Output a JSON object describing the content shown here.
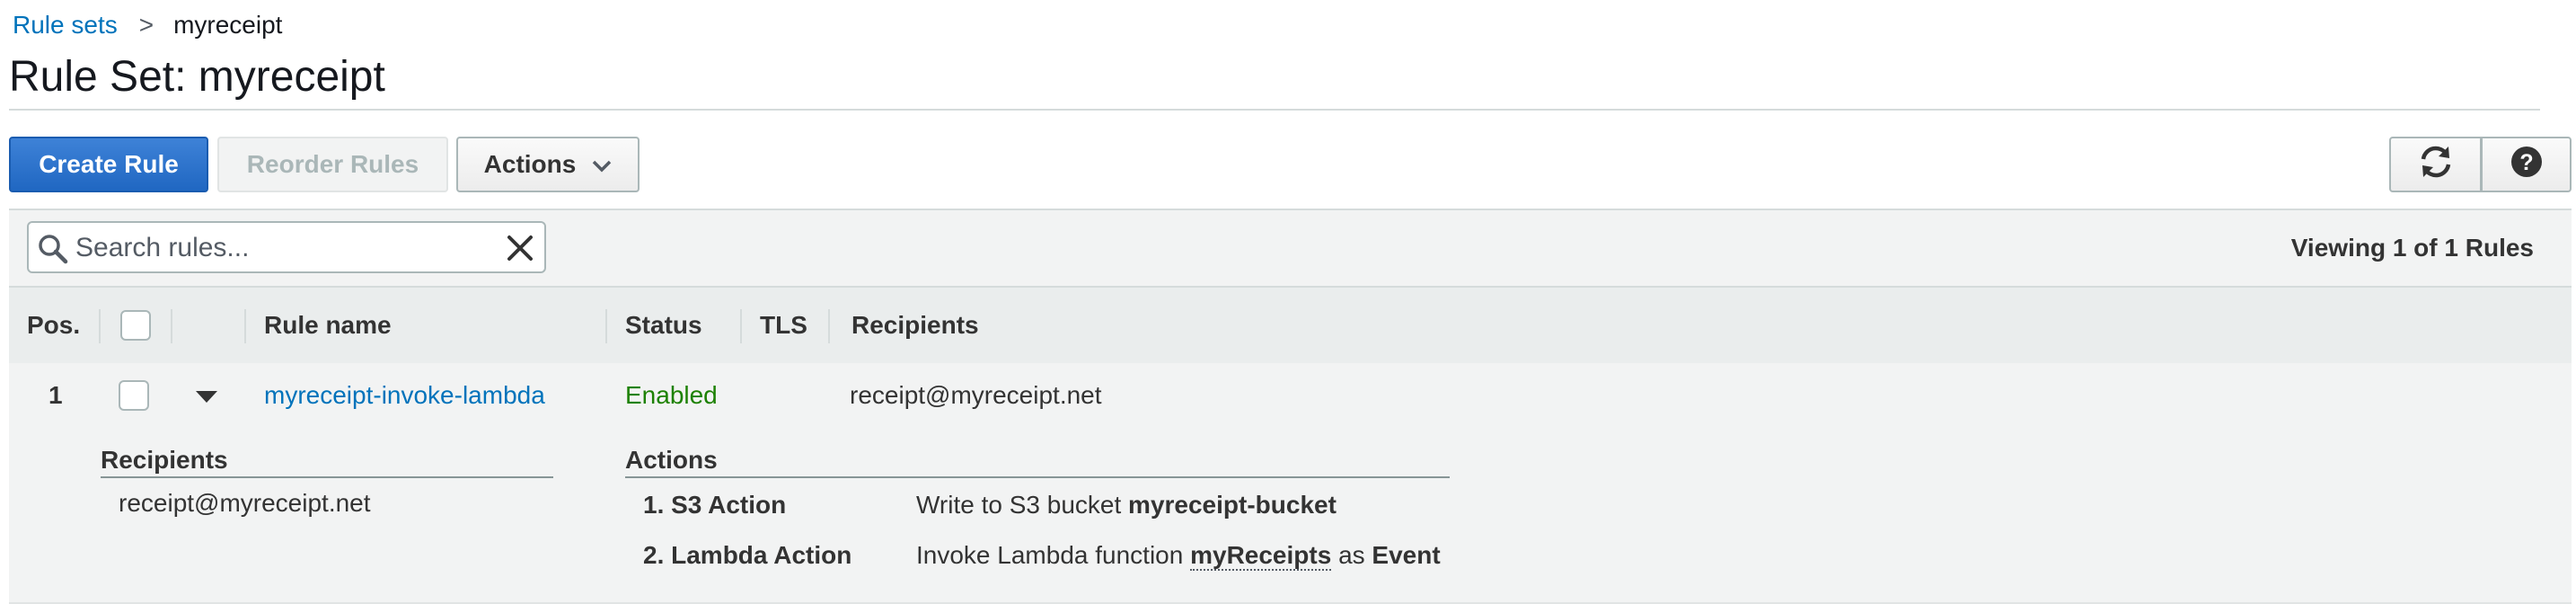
{
  "breadcrumb": {
    "root": "Rule sets",
    "separator": ">",
    "current": "myreceipt"
  },
  "page": {
    "title": "Rule Set: myreceipt"
  },
  "toolbar": {
    "create_label": "Create Rule",
    "reorder_label": "Reorder Rules",
    "actions_label": "Actions",
    "refresh_icon": "refresh-icon",
    "help_icon": "help-icon"
  },
  "filter": {
    "search_placeholder": "Search rules...",
    "search_value": "",
    "viewing": "Viewing 1 of 1 Rules"
  },
  "table": {
    "columns": [
      "Pos.",
      "Rule name",
      "Status",
      "TLS",
      "Recipients"
    ],
    "rows": [
      {
        "pos": "1",
        "name": "myreceipt-invoke-lambda",
        "status": "Enabled",
        "tls": "",
        "recipients": "receipt@myreceipt.net",
        "expanded": true
      }
    ]
  },
  "detail": {
    "recipients_heading": "Recipients",
    "recipients": [
      "receipt@myreceipt.net"
    ],
    "actions_heading": "Actions",
    "actions": [
      {
        "label": "1. S3 Action",
        "prefix": "Write to S3 bucket",
        "target": "myreceipt-bucket"
      },
      {
        "label": "2. Lambda Action",
        "prefix": "Invoke Lambda function",
        "target": "myReceipts",
        "as_word": "as",
        "invocation": "Event"
      }
    ]
  },
  "colors": {
    "primary": "#2067c2",
    "link": "#0073bb",
    "enabled": "#1d8102",
    "panel": "#f2f3f3"
  }
}
